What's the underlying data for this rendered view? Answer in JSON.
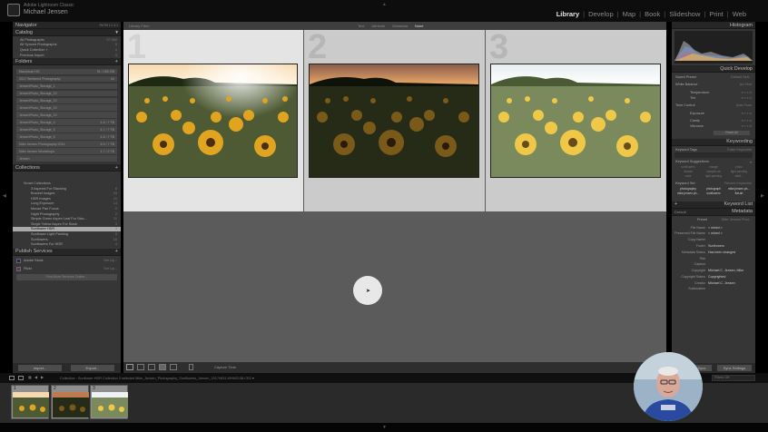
{
  "app": {
    "product": "Adobe Lightroom Classic",
    "user": "Michael Jensen"
  },
  "modules": [
    "Library",
    "Develop",
    "Map",
    "Book",
    "Slideshow",
    "Print",
    "Web"
  ],
  "active_module": "Library",
  "left_panel": {
    "navigator": {
      "title": "Navigator",
      "zoom_options": [
        "Fit",
        "Fill",
        "1:1",
        "3:1"
      ]
    },
    "catalog": {
      "title": "Catalog",
      "items": [
        {
          "label": "All Photographs",
          "count": "37,960"
        },
        {
          "label": "All Synced Photographs",
          "count": "0"
        },
        {
          "label": "Quick Collection +",
          "count": "0"
        },
        {
          "label": "Previous Import",
          "count": "3"
        }
      ]
    },
    "folders": {
      "title": "Folders",
      "items": [
        {
          "label": "Macintosh HD",
          "count": "91 / 250 GB"
        },
        {
          "label": "2017 Weekend Photography",
          "count": "54"
        },
        {
          "label": "JensenPhoto_Storage_1",
          "count": ""
        },
        {
          "label": "JensenPhoto_Storage_10",
          "count": ""
        },
        {
          "label": "JensenPhoto_Storage_10",
          "count": ""
        },
        {
          "label": "JensenPhoto_Storage_10",
          "count": ""
        },
        {
          "label": "JensenPhoto_Storage_10",
          "count": ""
        },
        {
          "label": "JensenPhoto_Storage_4",
          "count": "4.4 / 7 TB"
        },
        {
          "label": "JensenPhoto_Storage_5",
          "count": "4.7 / 7 TB"
        },
        {
          "label": "JensenPhoto_Storage_6",
          "count": "4.4 / 7 TB"
        },
        {
          "label": "Mike Jensen Photography 2014",
          "count": "6.9 / 7 TB"
        },
        {
          "label": "Mike Jensen Workshops",
          "count": "1.7 / 2 TB"
        },
        {
          "label": "Jensen",
          "count": ""
        }
      ]
    },
    "collections": {
      "title": "Collections",
      "items": [
        {
          "label": "Smart Collections",
          "count": ""
        },
        {
          "label": "3 Aspects For Stacking",
          "count": "6"
        },
        {
          "label": "Bracket Images",
          "count": "43"
        },
        {
          "label": "HDR Images",
          "count": "21"
        },
        {
          "label": "Long Exposure",
          "count": "13"
        },
        {
          "label": "Mouse Pan Focus",
          "count": "0"
        },
        {
          "label": "Night Photography",
          "count": "2"
        },
        {
          "label": "Simple Green Aspen Leaf For Stac...",
          "count": "11"
        },
        {
          "label": "Single Yellow Aspen For Stack",
          "count": "3"
        },
        {
          "label": "Sunflower HDR",
          "count": "3"
        },
        {
          "label": "Sunflower Light Painting",
          "count": "5"
        },
        {
          "label": "Sunflowers",
          "count": "16"
        },
        {
          "label": "Sunflowers For HDR",
          "count": "4"
        }
      ],
      "selected_index": 9
    },
    "publish": {
      "title": "Publish Services",
      "items": [
        {
          "label": "Adobe Stock",
          "action": "Set Up..."
        },
        {
          "label": "Flickr",
          "action": "Set Up..."
        }
      ],
      "find_more": "Find More Services Online..."
    },
    "import_label": "Import...",
    "export_label": "Export..."
  },
  "main": {
    "toolbar_label": "Library Filter:",
    "view_tabs": [
      "Text",
      "Attribute",
      "Metadata",
      "None"
    ],
    "active_tab": "None",
    "survey_numbers": [
      "1",
      "2",
      "3"
    ],
    "bottom_toolbar_label": "Capture Time",
    "left_arrow": "◀",
    "right_arrow": "▶"
  },
  "right_panel": {
    "histogram": {
      "title": "Histogram"
    },
    "quick_develop": {
      "title": "Quick Develop",
      "saved_preset_label": "Saved Preset",
      "saved_preset_value": "Default Sett...",
      "white_balance_label": "White Balance",
      "white_balance_value": "As Shot",
      "temperature_label": "Temperature",
      "tint_label": "Tint",
      "tone_control_label": "Tone Control",
      "tone_control_value": "Auto Tone",
      "exposure_label": "Exposure",
      "clarity_label": "Clarity",
      "vibrance_label": "Vibrance",
      "reset_label": "Reset All"
    },
    "keywording": {
      "title": "Keywording",
      "keyword_tags_label": "Keyword Tags",
      "keyword_tags_value": "Enter Keywords",
      "suggestions_label": "Keyword Suggestions",
      "suggestions": [
        "sunflowers",
        "orange",
        "photo",
        "Jensen",
        "sample cat",
        "light painting",
        "color",
        "light painting",
        "wildf..."
      ],
      "keyword_set_label": "Keyword Set",
      "keyword_set_value": "Recent Keywords",
      "keyword_set": [
        "photography",
        "photograph",
        "mike.jensen.ph...",
        "mike.jensen.ph...",
        "sunflowers",
        "flat.art",
        "",
        "",
        ""
      ]
    },
    "keyword_list": {
      "title": "Keyword List"
    },
    "metadata": {
      "title": "Metadata",
      "default_label": "Default",
      "preset_label": "Preset",
      "preset_value": "Mike Jensen Phot...",
      "fields": [
        {
          "label": "File Name",
          "value": "< mixed >"
        },
        {
          "label": "Preserved File Name",
          "value": "< mixed >"
        },
        {
          "label": "Copy Name",
          "value": ""
        },
        {
          "label": "Folder",
          "value": "Sunflowers"
        },
        {
          "label": "Metadata Status",
          "value": "Has been changed"
        },
        {
          "label": "Title",
          "value": ""
        },
        {
          "label": "Caption",
          "value": ""
        },
        {
          "label": "Copyright",
          "value": "Michael C. Jensen, Mike"
        },
        {
          "label": "Copyright Status",
          "value": "Copyrighted"
        },
        {
          "label": "Creator",
          "value": "Michael C. Jensen"
        },
        {
          "label": "Sublocation",
          "value": ""
        }
      ]
    },
    "sync_label": "Sync",
    "sync_settings_label": "Sync Settings"
  },
  "filmstrip": {
    "breadcrumb": "Collection : Sunflower HDR    Collection  3 selected  Mike_Jensen_Photography_Sunflowers_Jensen_20170831-MHM2138.CR2 ▾",
    "filter_label": "Filter :",
    "filter_value": "Filters Off",
    "thumb_numbers": [
      "1",
      "2",
      "3"
    ]
  },
  "colors": {
    "panel": "#363636",
    "panel_header": "#262626",
    "main_bg": "#5b5b5b",
    "survey_cell_selected": "#e4e4e4",
    "survey_cell": "#cbcbcb",
    "active_module": "#e6e6e6"
  }
}
